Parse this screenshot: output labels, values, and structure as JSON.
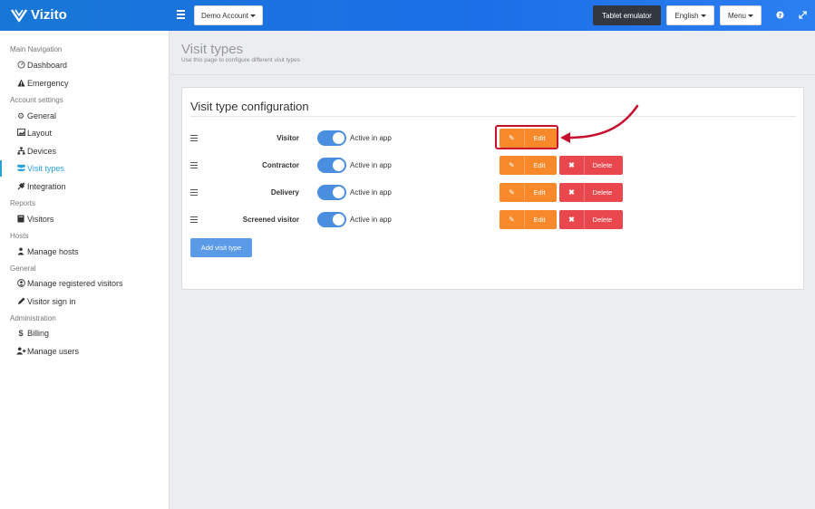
{
  "app": {
    "name": "Vizito"
  },
  "header": {
    "account_label": "Demo Account",
    "tablet_label": "Tablet emulator",
    "language_label": "English",
    "menu_label": "Menu",
    "help_icon": "question-icon",
    "fullscreen_icon": "expand-icon"
  },
  "sidebar": {
    "sections": [
      {
        "title": "Main Navigation",
        "items": [
          {
            "label": "Dashboard",
            "icon": "gauge-icon"
          },
          {
            "label": "Emergency",
            "icon": "warning-icon"
          }
        ]
      },
      {
        "title": "Account settings",
        "items": [
          {
            "label": "General",
            "icon": "gear-icon"
          },
          {
            "label": "Layout",
            "icon": "image-icon"
          },
          {
            "label": "Devices",
            "icon": "sitemap-icon"
          },
          {
            "label": "Visit types",
            "icon": "users-icon",
            "active": true
          },
          {
            "label": "Integration",
            "icon": "plug-icon"
          }
        ]
      },
      {
        "title": "Reports",
        "items": [
          {
            "label": "Visitors",
            "icon": "book-icon"
          }
        ]
      },
      {
        "title": "Hosts",
        "items": [
          {
            "label": "Manage hosts",
            "icon": "user-icon"
          }
        ]
      },
      {
        "title": "General",
        "items": [
          {
            "label": "Manage registered visitors",
            "icon": "user-circle-icon"
          },
          {
            "label": "Visitor sign in",
            "icon": "pencil-icon"
          }
        ]
      },
      {
        "title": "Administration",
        "items": [
          {
            "label": "Billing",
            "icon": "dollar-icon"
          },
          {
            "label": "Manage users",
            "icon": "user-plus-icon"
          }
        ]
      }
    ]
  },
  "page": {
    "title": "Visit types",
    "subtitle": "Use this page to configure different visit types"
  },
  "panel": {
    "title": "Visit type configuration",
    "toggle_label": "Active in app",
    "edit_label": "Edit",
    "delete_label": "Delete",
    "add_label": "Add visit type",
    "rows": [
      {
        "name": "Visitor",
        "active": true,
        "deletable": false
      },
      {
        "name": "Contractor",
        "active": true,
        "deletable": true
      },
      {
        "name": "Delivery",
        "active": true,
        "deletable": true
      },
      {
        "name": "Screened visitor",
        "active": true,
        "deletable": true
      }
    ]
  },
  "colors": {
    "topbar": "#1c6fe8",
    "accent": "#28a0d8",
    "edit": "#f7892a",
    "delete": "#e8474d",
    "toggle": "#4a8ee0",
    "annotation": "#c8102e"
  }
}
